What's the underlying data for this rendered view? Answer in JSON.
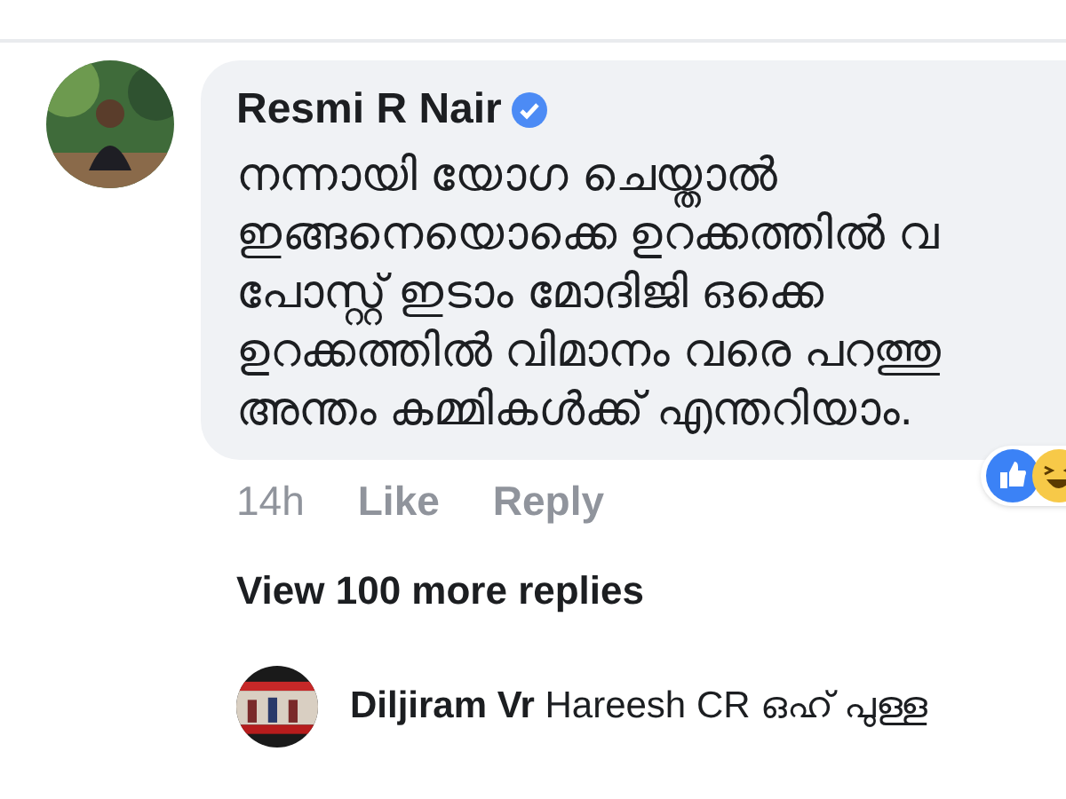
{
  "comment": {
    "author": "Resmi R Nair",
    "verified": true,
    "lines": [
      "നന്നായി യോഗ ചെയ്താൽ",
      "ഇങ്ങനെയൊക്കെ ഉറക്കത്തിൽ വ",
      "പോസ്റ്റ് ഇടാം മോദിജി ഒക്കെ",
      "ഉറക്കത്തിൽ വിമാനം വരെ പറത്തു",
      "അന്തം കമ്മികൾക്ക് എന്തറിയാം."
    ],
    "time": "14h",
    "actions": [
      "Like",
      "Reply"
    ]
  },
  "view_more": "View 100 more replies",
  "reply": {
    "author": "Diljiram Vr",
    "mention": "Hareesh CR",
    "text": "ഒഹ് പുള്ള"
  }
}
